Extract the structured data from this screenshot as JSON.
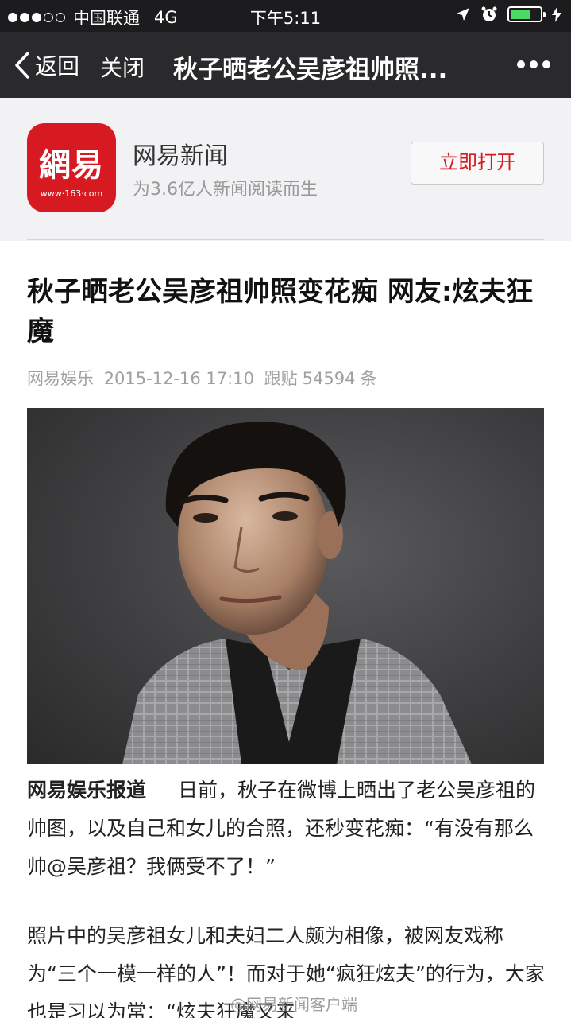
{
  "status_bar": {
    "carrier": "中国联通",
    "network": "4G",
    "time": "下午5:11",
    "signal_bars_filled": 3,
    "signal_bars_total": 5,
    "battery_level": 0.7,
    "battery_color": "#4cd964"
  },
  "nav": {
    "back_label": "返回",
    "close_label": "关闭",
    "title": "秋子晒老公吴彦祖帅照..."
  },
  "app_banner": {
    "logo_text": "網易",
    "logo_subtext": "www·163·com",
    "name": "网易新闻",
    "slogan": "为3.6亿人新闻阅读而生",
    "open_button": "立即打开",
    "brand_color": "#d71921"
  },
  "article": {
    "title": "秋子晒老公吴彦祖帅照变花痴 网友:炫夫狂魔",
    "source": "网易娱乐",
    "date": "2015-12-16 17:10",
    "comments_prefix": "跟贴",
    "comments_count": "54594",
    "comments_suffix": "条",
    "para1_lead": "网易娱乐报道",
    "para1_text": "日前，秋子在微博上晒出了老公吴彦祖的帅图，以及自己和女儿的合照，还秒变花痴：“有没有那么帅@吴彦祖？我俩受不了！”",
    "para2_text": "照片中的吴彦祖女儿和夫妇二人颇为相像，被网友戏称为“三个一模一样的人”！而对于她“疯狂炫夫”的行为，大家也是习以为常：“炫夫狂魔又来"
  },
  "watermark": "@网易新闻客户端"
}
